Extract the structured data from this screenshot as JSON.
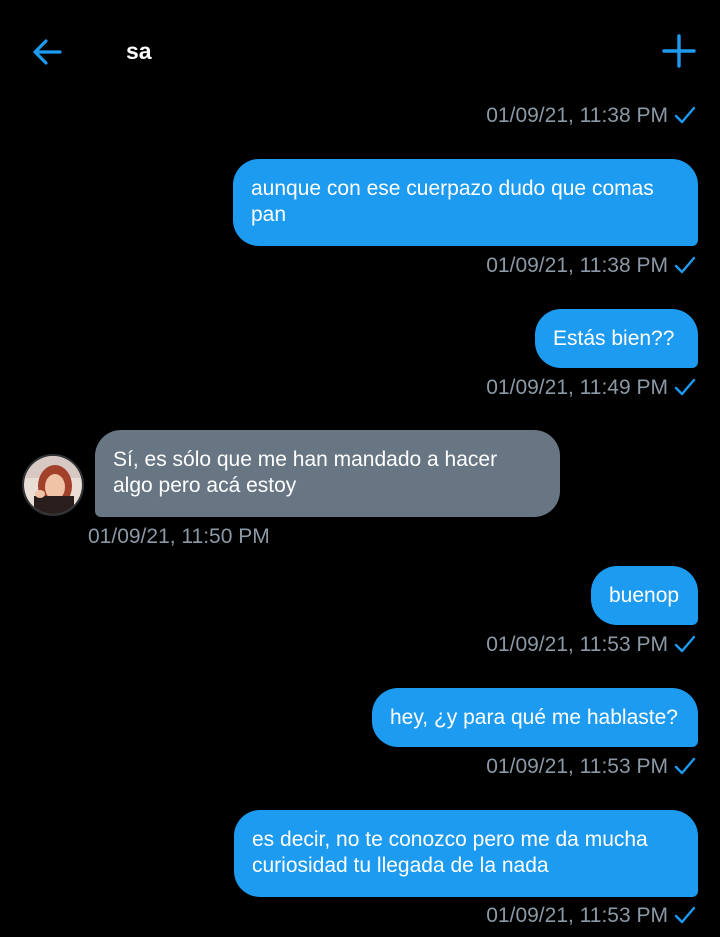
{
  "header": {
    "title": "sa",
    "back_icon": "arrow-left-icon",
    "new_icon": "plus-icon",
    "accent_color": "#1d9bf0"
  },
  "colors": {
    "outgoing_bubble": "#1d9bf0",
    "incoming_bubble": "#687684",
    "timestamp": "#8b98a5",
    "background": "#000000"
  },
  "messages": [
    {
      "direction": "out",
      "timestamp": "01/09/21, 11:38 PM",
      "read": true
    },
    {
      "direction": "out",
      "text_line1": "aunque con ese cuerpazo dudo que comas",
      "text_line2": "pan",
      "timestamp": "01/09/21, 11:38 PM",
      "read": true
    },
    {
      "direction": "out",
      "text_line1": "Estás bien??",
      "timestamp": "01/09/21, 11:49 PM",
      "read": true
    },
    {
      "direction": "in",
      "text_line1": "Sí, es sólo que me han mandado a hacer",
      "text_line2": "algo pero acá estoy",
      "timestamp": "01/09/21, 11:50 PM"
    },
    {
      "direction": "out",
      "text_line1": "buenop",
      "timestamp": "01/09/21, 11:53 PM",
      "read": true
    },
    {
      "direction": "out",
      "text_line1": "hey, ¿y para qué me hablaste?",
      "timestamp": "01/09/21, 11:53 PM",
      "read": true
    },
    {
      "direction": "out",
      "text_line1": "es decir, no te conozco pero me da mucha",
      "text_line2": "curiosidad tu llegada de la nada",
      "timestamp": "01/09/21, 11:53 PM",
      "read": true
    }
  ]
}
